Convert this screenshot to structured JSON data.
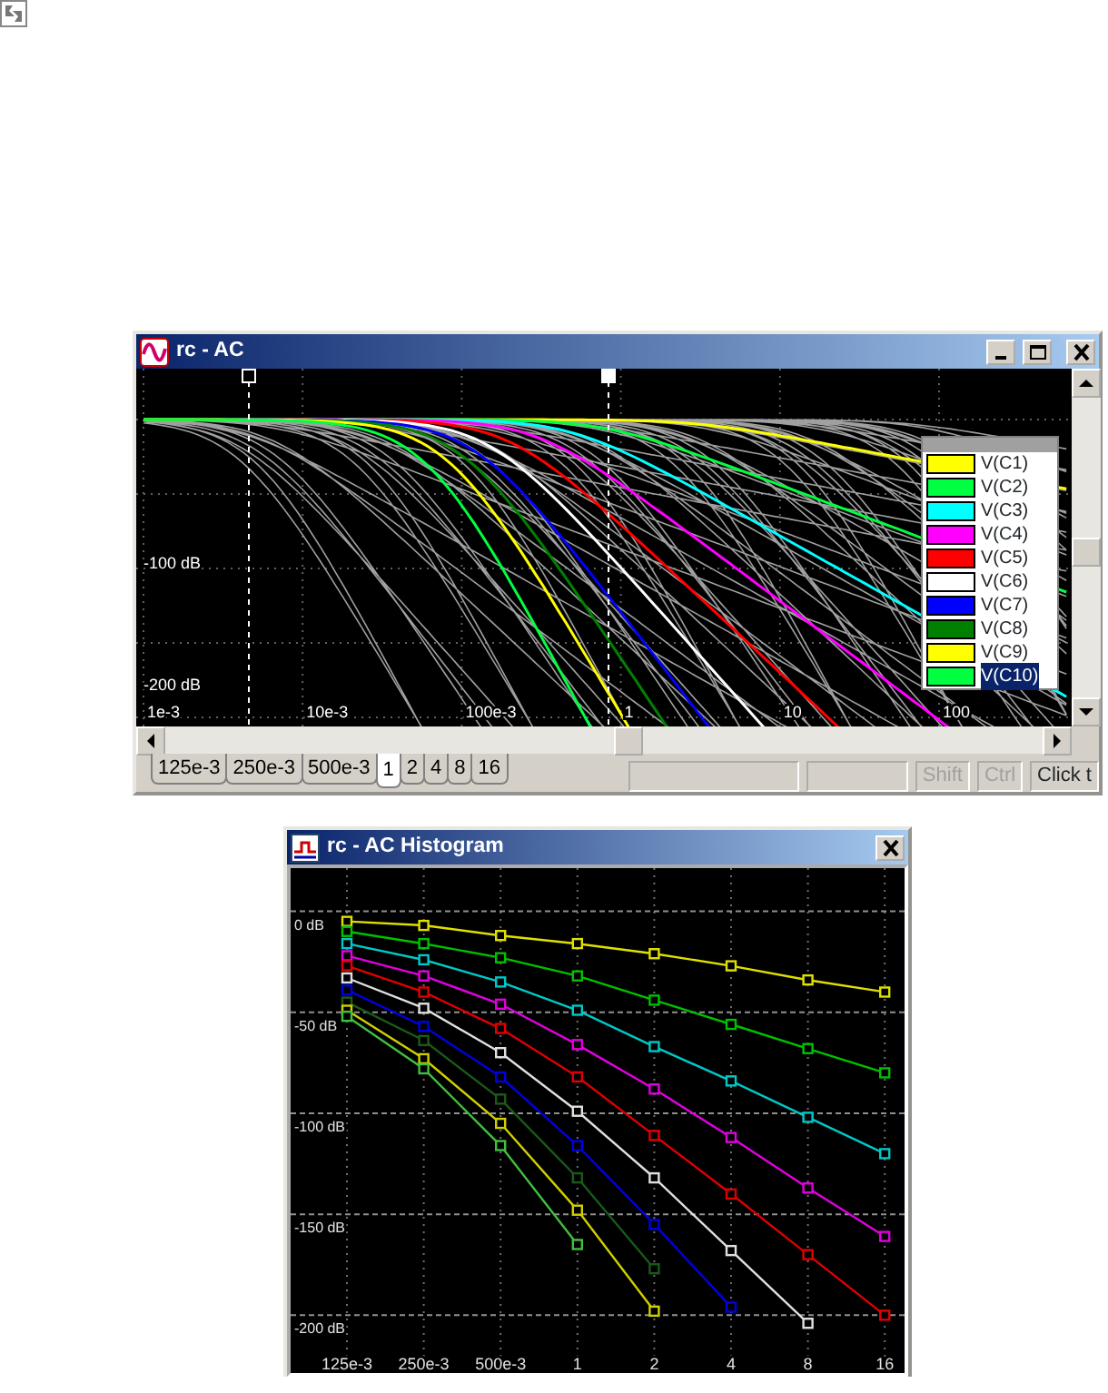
{
  "ac_window": {
    "title": "rc - AC",
    "plot": {
      "y_labels": [
        "-100 dB",
        "-200 dB"
      ],
      "x_labels": [
        "1e-3",
        "10e-3",
        "100e-3",
        "1",
        "10",
        "100"
      ]
    },
    "legend": [
      {
        "label": "V(C1)",
        "color": "#ffff00",
        "selected": false
      },
      {
        "label": "V(C2)",
        "color": "#00ff40",
        "selected": false
      },
      {
        "label": "V(C3)",
        "color": "#00ffff",
        "selected": false
      },
      {
        "label": "V(C4)",
        "color": "#ff00ff",
        "selected": false
      },
      {
        "label": "V(C5)",
        "color": "#ff0000",
        "selected": false
      },
      {
        "label": "V(C6)",
        "color": "#ffffff",
        "selected": false
      },
      {
        "label": "V(C7)",
        "color": "#0000ff",
        "selected": false
      },
      {
        "label": "V(C8)",
        "color": "#008000",
        "selected": false
      },
      {
        "label": "V(C9)",
        "color": "#ffff00",
        "selected": false
      },
      {
        "label": "V(C10)",
        "color": "#00ff40",
        "selected": true
      }
    ],
    "tabs": [
      {
        "label": "125e-3",
        "selected": false
      },
      {
        "label": "250e-3",
        "selected": false
      },
      {
        "label": "500e-3",
        "selected": false
      },
      {
        "label": "1",
        "selected": true
      },
      {
        "label": "2",
        "selected": false
      },
      {
        "label": "4",
        "selected": false
      },
      {
        "label": "8",
        "selected": false
      },
      {
        "label": "16",
        "selected": false
      }
    ],
    "status_bar": [
      {
        "label": "Shift",
        "disabled": true
      },
      {
        "label": "Ctrl",
        "disabled": true
      },
      {
        "label": "Click t",
        "disabled": false
      }
    ]
  },
  "histogram_window": {
    "title": "rc - AC Histogram",
    "chart_data": {
      "type": "line",
      "grid": true,
      "categories": [
        "125e-3",
        "250e-3",
        "500e-3",
        "1",
        "2",
        "4",
        "8",
        "16"
      ],
      "ylim": [
        -228,
        22
      ],
      "yticks": [
        {
          "value": 0,
          "label": "0 dB"
        },
        {
          "value": -50,
          "label": "-50 dB"
        },
        {
          "value": -100,
          "label": "-100 dB"
        },
        {
          "value": -150,
          "label": "-150 dB"
        },
        {
          "value": -200,
          "label": "-200 dB"
        }
      ],
      "series": [
        {
          "color": "#e0e000",
          "marker": "square",
          "values": [
            -5,
            -7,
            -12,
            -16,
            -21,
            -27,
            -34,
            -40
          ]
        },
        {
          "color": "#00c000",
          "marker": "square",
          "values": [
            -10,
            -16,
            -23,
            -32,
            -44,
            -56,
            -68,
            -80
          ]
        },
        {
          "color": "#00c8c8",
          "marker": "square",
          "values": [
            -16,
            -24,
            -35,
            -49,
            -67,
            -84,
            -102,
            -120
          ]
        },
        {
          "color": "#e000e0",
          "marker": "square",
          "values": [
            -22,
            -32,
            -46,
            -66,
            -88,
            -112,
            -137,
            -161
          ]
        },
        {
          "color": "#e00000",
          "marker": "square",
          "values": [
            -27,
            -40,
            -58,
            -82,
            -111,
            -140,
            -170,
            -200
          ]
        },
        {
          "color": "#e0e0e0",
          "marker": "square",
          "values": [
            -33,
            -48,
            -70,
            -99,
            -132,
            -168,
            -204,
            null
          ]
        },
        {
          "color": "#0000e0",
          "marker": "square",
          "values": [
            -39,
            -57,
            -82,
            -116,
            -155,
            -196,
            null,
            null
          ]
        },
        {
          "color": "#1a5a1a",
          "marker": "square",
          "values": [
            -45,
            -64,
            -93,
            -132,
            -177,
            null,
            null,
            null
          ]
        },
        {
          "color": "#d0d000",
          "marker": "square",
          "values": [
            -49,
            -73,
            -105,
            -148,
            -198,
            null,
            null,
            null
          ]
        },
        {
          "color": "#40c040",
          "marker": "square",
          "values": [
            -52,
            -78,
            -116,
            -165,
            null,
            null,
            null,
            null
          ]
        }
      ]
    }
  }
}
